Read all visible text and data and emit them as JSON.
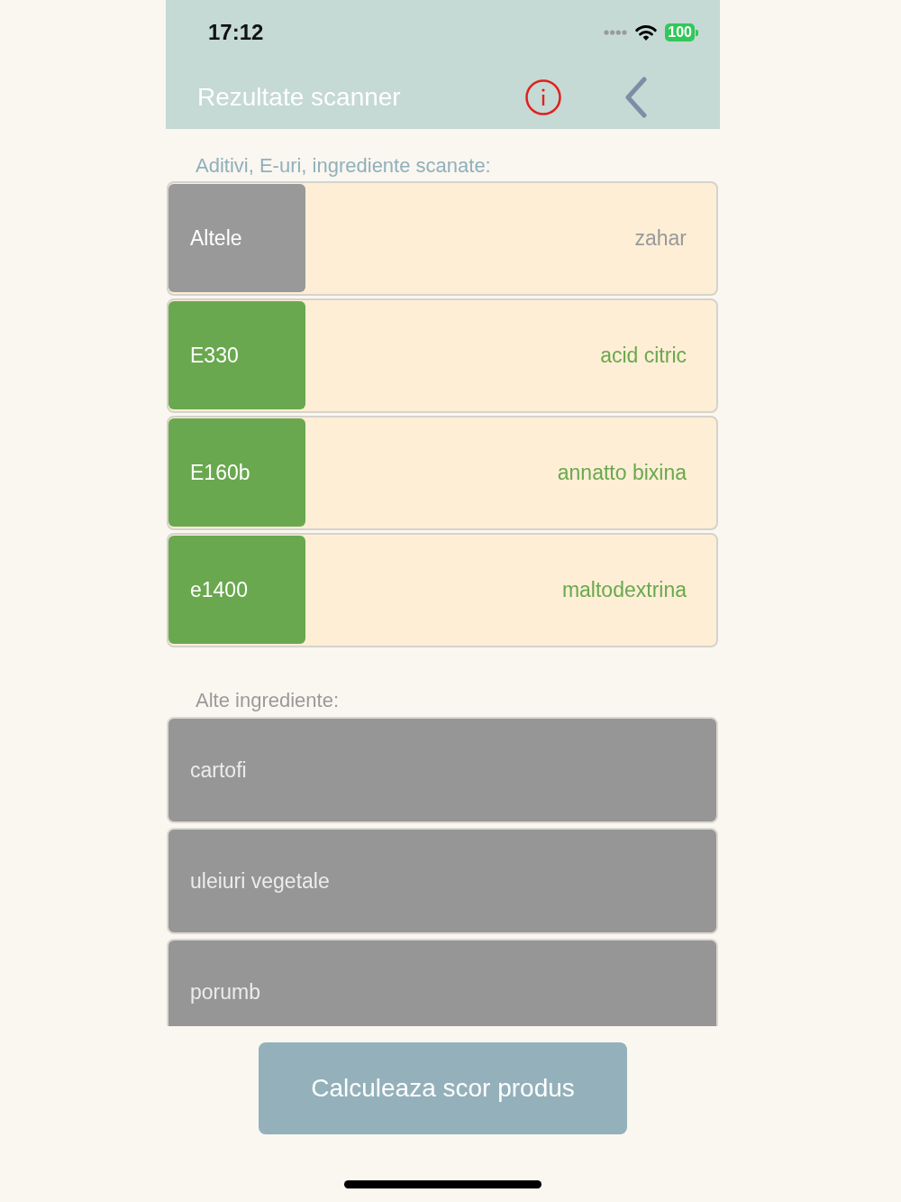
{
  "status_bar": {
    "time": "17:12",
    "battery": "100"
  },
  "header": {
    "title": "Rezultate scanner"
  },
  "scanned_section": {
    "label": "Aditivi, E-uri, ingrediente scanate:",
    "items": [
      {
        "code": "Altele",
        "name": "zahar",
        "color": "#999999"
      },
      {
        "code": "E330",
        "name": "acid citric",
        "color": "#6aa84f"
      },
      {
        "code": "E160b",
        "name": "annatto bixina",
        "color": "#6aa84f"
      },
      {
        "code": "e1400",
        "name": "maltodextrina",
        "color": "#6aa84f"
      }
    ]
  },
  "other_section": {
    "label": "Alte ingrediente:",
    "items": [
      "cartofi",
      "uleiuri vegetale",
      "porumb"
    ]
  },
  "primary_button": "Calculeaza scor produs"
}
